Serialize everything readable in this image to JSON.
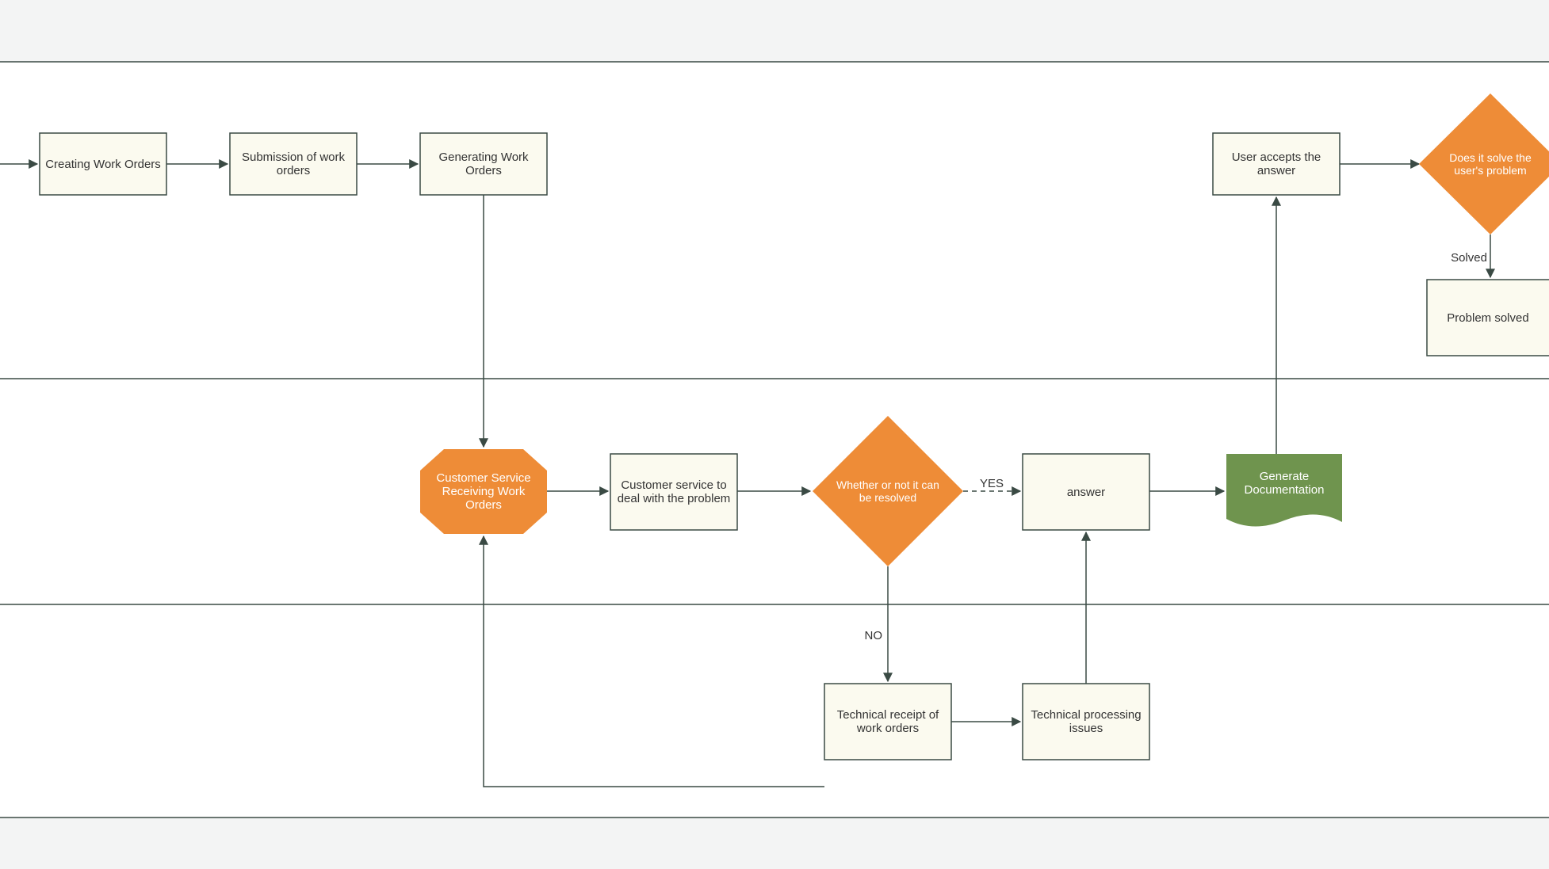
{
  "nodes": {
    "creating": "Creating Work Orders",
    "submission": "Submission of work orders",
    "generating": "Generating Work Orders",
    "cs_receiving": "Customer Service Receiving Work Orders",
    "cs_deal": "Customer service to deal with the problem",
    "can_resolve": "Whether or not it can be resolved",
    "answer": "answer",
    "generate_doc": "Generate Documentation",
    "user_accepts": "User accepts the answer",
    "does_solve": "Does it solve the user's problem",
    "problem_solved": "Problem solved",
    "tech_receipt": "Technical receipt of work orders",
    "tech_process": "Technical processing issues"
  },
  "labels": {
    "yes": "YES",
    "no": "NO",
    "solved": "Solved"
  },
  "palette": {
    "box_fill": "#fbfaef",
    "box_stroke": "#3a4a44",
    "diamond_fill": "#ee8c37",
    "doc_fill": "#6f944e",
    "bg": "#f3f4f4",
    "canvas": "#ffffff"
  },
  "lanes": {
    "count": 3,
    "y_dividers": [
      60,
      358,
      573,
      770
    ]
  }
}
